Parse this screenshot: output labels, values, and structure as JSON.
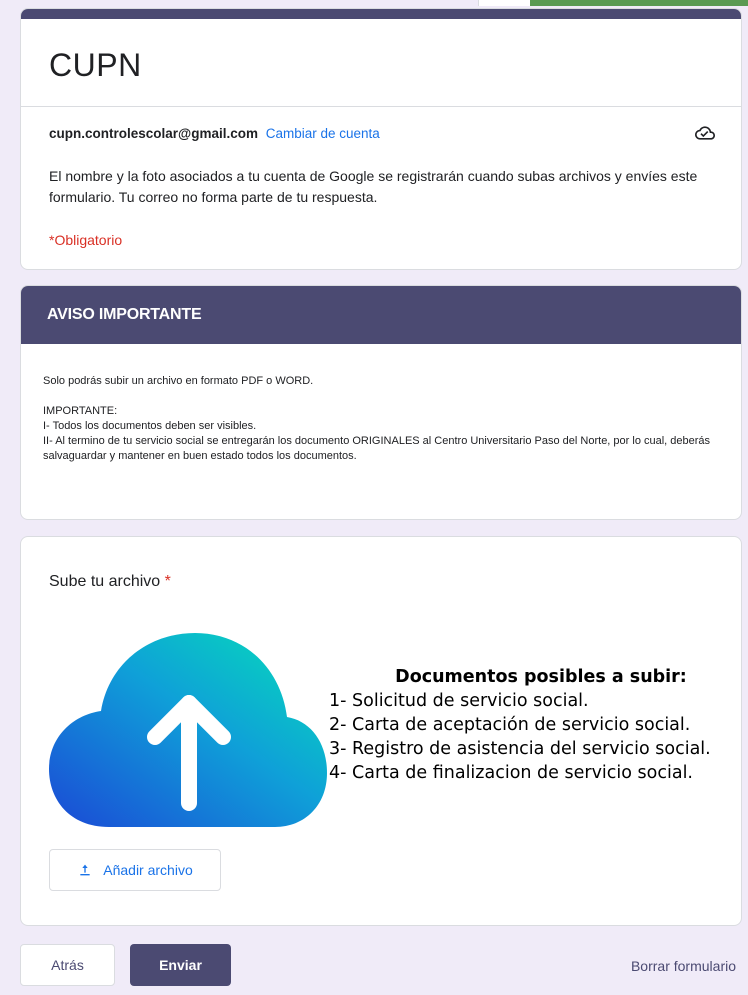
{
  "form": {
    "title": "CUPN",
    "account_email": "cupn.controlescolar@gmail.com",
    "switch_account": "Cambiar de cuenta",
    "notice": "El nombre y la foto asociados a tu cuenta de Google se registrarán cuando subas archivos y envíes este formulario. Tu correo no forma parte de tu respuesta.",
    "required_note": "*Obligatorio"
  },
  "section": {
    "title": "AVISO IMPORTANTE",
    "line1": "Solo podrás subir un archivo en formato PDF o WORD.",
    "line2": "IMPORTANTE:",
    "line3": "I- Todos los documentos deben ser visibles.",
    "line4": "II- Al termino de tu servicio social se entregarán los documento ORIGINALES al Centro Universitario Paso del Norte, por lo cual, deberás salvaguardar y mantener en buen estado todos los documentos."
  },
  "question": {
    "label": "Sube tu archivo",
    "required_mark": "*",
    "docs_title": "Documentos posibles a subir:",
    "docs": [
      "1- Solicitud de servicio social.",
      "2- Carta de aceptación de servicio social.",
      "3- Registro de asistencia del servicio social.",
      "4- Carta de finalizacion de servicio social."
    ],
    "add_file": "Añadir archivo"
  },
  "footer": {
    "back": "Atrás",
    "send": "Enviar",
    "clear": "Borrar formulario"
  },
  "colors": {
    "accent": "#4b4a72",
    "link": "#1a73e8",
    "required": "#d93025",
    "background": "#f0ebf8"
  },
  "icons": [
    "cloud-check-icon",
    "cloud-upload-icon",
    "upload-icon"
  ]
}
